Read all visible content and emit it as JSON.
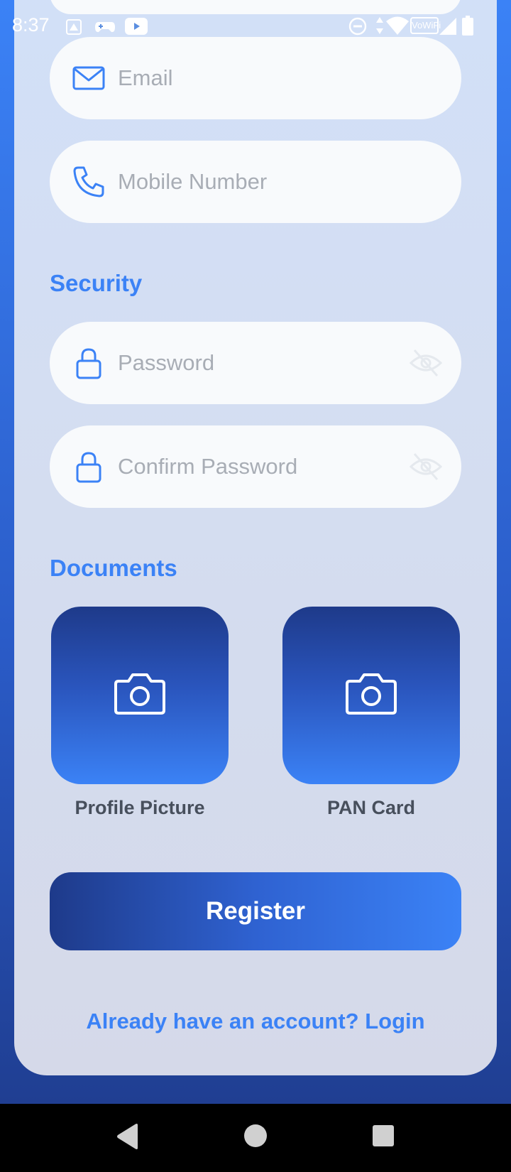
{
  "status_bar": {
    "time": "8:37",
    "vowifi_label": "VoWiFi"
  },
  "contact": {
    "email_placeholder": "Email",
    "mobile_placeholder": "Mobile Number"
  },
  "security": {
    "title": "Security",
    "password_placeholder": "Password",
    "confirm_password_placeholder": "Confirm Password"
  },
  "documents": {
    "title": "Documents",
    "items": [
      {
        "label": "Profile Picture",
        "icon": "camera-icon"
      },
      {
        "label": "PAN Card",
        "icon": "camera-icon"
      }
    ]
  },
  "actions": {
    "register_label": "Register",
    "login_link": "Already have an account? Login"
  },
  "theme": {
    "accent": "#3b82f6",
    "accent_dark": "#1e3a8a",
    "field_background": "#f8fafc",
    "placeholder_color": "#a8adb5"
  },
  "icons": [
    "mail-icon",
    "phone-icon",
    "lock-icon",
    "eye-off-icon",
    "camera-icon",
    "back-icon",
    "home-icon",
    "recents-icon"
  ]
}
